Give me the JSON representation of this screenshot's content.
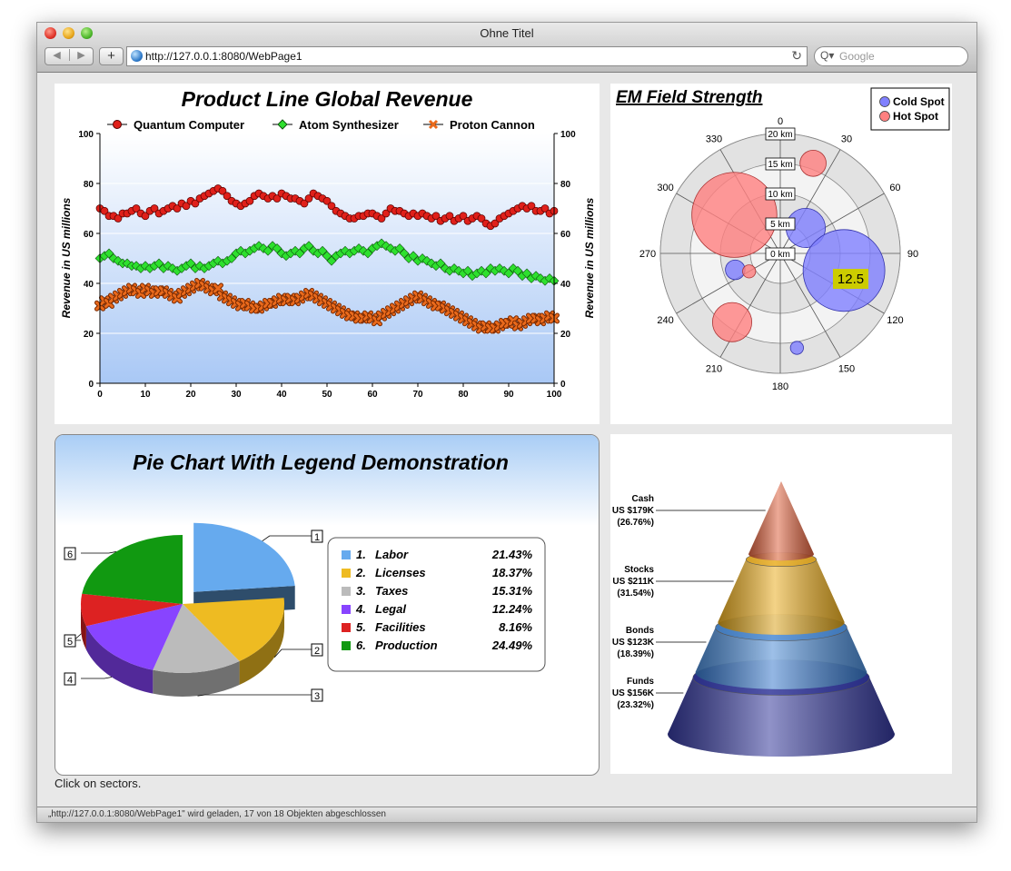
{
  "window": {
    "title": "Ohne Titel"
  },
  "toolbar": {
    "back": "◀",
    "forward": "▶",
    "add": "+",
    "url": "http://127.0.0.1:8080/WebPage1",
    "reload": "↻",
    "search_placeholder": "Google",
    "search_icon": "Q▾"
  },
  "status_text": "„http://127.0.0.1:8080/WebPage1\" wird geladen, 17 von 18 Objekten abgeschlossen",
  "hint": "Click on sectors.",
  "line_chart": {
    "chart_data": {
      "type": "line",
      "title": "Product Line Global Revenue",
      "ylabel": "Revenue in US millions",
      "y2label": "Revenue in US millions",
      "xlim": [
        0,
        100
      ],
      "ylim": [
        0,
        100
      ],
      "xticks": [
        "0",
        "10",
        "20",
        "30",
        "40",
        "50",
        "60",
        "70",
        "80",
        "90",
        "100"
      ],
      "yticks": [
        "0",
        "20",
        "40",
        "60",
        "80",
        "100"
      ],
      "legend_position": "top",
      "series": [
        {
          "name": "Quantum Computer",
          "color": "#e0201a",
          "marker": "circle",
          "values": [
            70,
            69,
            67,
            67,
            66,
            68,
            68,
            69,
            70,
            68,
            67,
            69,
            70,
            68,
            69,
            70,
            71,
            70,
            72,
            71,
            73,
            72,
            74,
            75,
            76,
            77,
            78,
            77,
            75,
            73,
            72,
            71,
            72,
            73,
            75,
            76,
            75,
            74,
            75,
            74,
            76,
            75,
            74,
            74,
            73,
            72,
            74,
            76,
            75,
            74,
            73,
            71,
            69,
            68,
            67,
            66,
            66,
            67,
            67,
            68,
            68,
            67,
            66,
            68,
            70,
            69,
            69,
            68,
            67,
            68,
            67,
            68,
            67,
            66,
            67,
            65,
            66,
            67,
            65,
            66,
            67,
            65,
            66,
            67,
            66,
            64,
            63,
            64,
            66,
            67,
            68,
            69,
            70,
            71,
            70,
            71,
            69,
            69,
            70,
            68,
            69
          ]
        },
        {
          "name": "Atom Synthesizer",
          "color": "#2ee02e",
          "marker": "diamond",
          "values": [
            50,
            51,
            52,
            50,
            49,
            48,
            48,
            47,
            47,
            46,
            47,
            46,
            47,
            48,
            46,
            47,
            46,
            45,
            46,
            47,
            48,
            46,
            47,
            46,
            47,
            48,
            49,
            48,
            49,
            50,
            52,
            53,
            52,
            53,
            54,
            55,
            54,
            53,
            55,
            54,
            52,
            51,
            52,
            53,
            52,
            54,
            55,
            53,
            52,
            53,
            51,
            49,
            51,
            52,
            53,
            52,
            53,
            54,
            53,
            52,
            54,
            55,
            56,
            55,
            54,
            53,
            54,
            52,
            50,
            51,
            49,
            50,
            49,
            48,
            47,
            48,
            46,
            45,
            46,
            45,
            44,
            45,
            43,
            44,
            45,
            44,
            46,
            45,
            46,
            45,
            44,
            46,
            45,
            43,
            44,
            42,
            43,
            42,
            41,
            42,
            41
          ]
        },
        {
          "name": "Proton Cannon",
          "color": "#ea6a1c",
          "marker": "cross",
          "values": [
            31,
            33,
            32,
            34,
            35,
            36,
            37,
            38,
            37,
            36,
            38,
            37,
            36,
            37,
            37,
            36,
            35,
            34,
            36,
            37,
            38,
            39,
            40,
            39,
            38,
            37,
            38,
            35,
            34,
            33,
            32,
            31,
            32,
            31,
            30,
            30,
            31,
            32,
            32,
            33,
            34,
            33,
            34,
            33,
            34,
            35,
            36,
            35,
            34,
            33,
            32,
            31,
            30,
            29,
            28,
            27,
            27,
            26,
            26,
            27,
            26,
            25,
            27,
            28,
            29,
            30,
            31,
            32,
            33,
            34,
            35,
            34,
            33,
            32,
            31,
            31,
            30,
            29,
            28,
            27,
            26,
            25,
            24,
            23,
            22,
            23,
            22,
            22,
            23,
            24,
            24,
            25,
            23,
            24,
            25,
            26,
            26,
            25,
            26,
            27,
            26
          ]
        }
      ]
    }
  },
  "polar_chart": {
    "chart_data": {
      "type": "scatter",
      "title": "EM Field Strength",
      "legend": [
        "Cold Spot",
        "Hot Spot"
      ],
      "legend_position": "top-right",
      "radial_labels": [
        "0 km",
        "5 km",
        "10 km",
        "15 km",
        "20 km"
      ],
      "angle_labels": [
        "0",
        "30",
        "60",
        "90",
        "120",
        "150",
        "180",
        "210",
        "240",
        "270",
        "300",
        "330"
      ],
      "annotation": "12.5",
      "series": [
        {
          "name": "Cold Spot",
          "color": "#8080ff",
          "points": [
            {
              "angle": 45,
              "r": 6,
              "size": 6
            },
            {
              "angle": 105,
              "r": 11,
              "size": 12.5
            },
            {
              "angle": 250,
              "r": 8,
              "size": 3
            },
            {
              "angle": 170,
              "r": 16,
              "size": 2
            }
          ]
        },
        {
          "name": "Hot Spot",
          "color": "#ff8080",
          "points": [
            {
              "angle": 310,
              "r": 10,
              "size": 13
            },
            {
              "angle": 20,
              "r": 16,
              "size": 4
            },
            {
              "angle": 240,
              "r": 6,
              "size": 2
            },
            {
              "angle": 215,
              "r": 14,
              "size": 6
            }
          ]
        }
      ]
    }
  },
  "pie_chart": {
    "chart_data": {
      "type": "pie",
      "title": "Pie Chart With Legend Demonstration",
      "categories": [
        "Labor",
        "Licenses",
        "Taxes",
        "Legal",
        "Facilities",
        "Production"
      ],
      "values": [
        25,
        18,
        15,
        16,
        8,
        24
      ],
      "percent_labels": [
        "21.43%",
        "18.37%",
        "15.31%",
        "12.24%",
        "8.16%",
        "24.49%"
      ],
      "numbers": [
        "1.",
        "2.",
        "3.",
        "4.",
        "5.",
        "6."
      ],
      "colors": [
        "#66aaee",
        "#eebb22",
        "#bbbbbb",
        "#8844ff",
        "#dd2222",
        "#119911"
      ]
    }
  },
  "cone_chart": {
    "chart_data": {
      "type": "bar",
      "categories": [
        "Cash",
        "Stocks",
        "Bonds",
        "Funds"
      ],
      "value_labels": [
        "US $179K",
        "US $211K",
        "US $123K",
        "US $156K"
      ],
      "percent_labels": [
        "(26.76%)",
        "(31.54%)",
        "(18.39%)",
        "(23.32%)"
      ],
      "colors": [
        "#d9532c",
        "#e8a50c",
        "#3a7fd0",
        "#1f2490"
      ]
    }
  }
}
